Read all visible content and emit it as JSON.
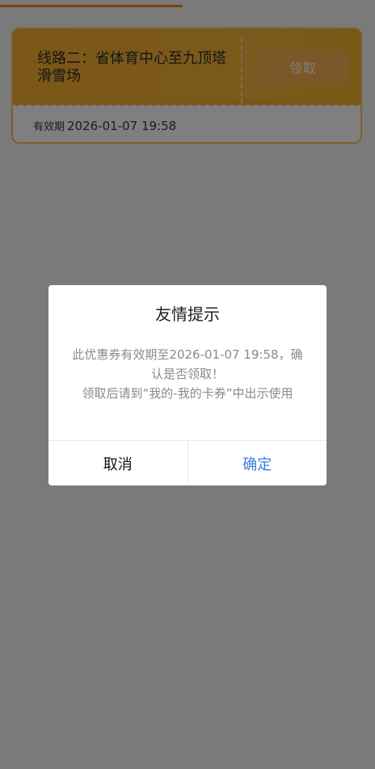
{
  "coupon": {
    "title": "线路二：省体育中心至九顶塔滑雪场",
    "claim_label": "领取",
    "validity_label": "有效期",
    "validity_value": "2026-01-07 19:58"
  },
  "dialog": {
    "title": "友情提示",
    "message": "此优惠券有效期至2026-01-07 19:58，确认是否领取！\n领取后请到“我的-我的卡券”中出示使用",
    "cancel_label": "取消",
    "confirm_label": "确定"
  },
  "colors": {
    "accent_orange": "#f6ae2f",
    "tab_indicator": "#f08a22",
    "confirm_blue": "#3b7cd9"
  }
}
